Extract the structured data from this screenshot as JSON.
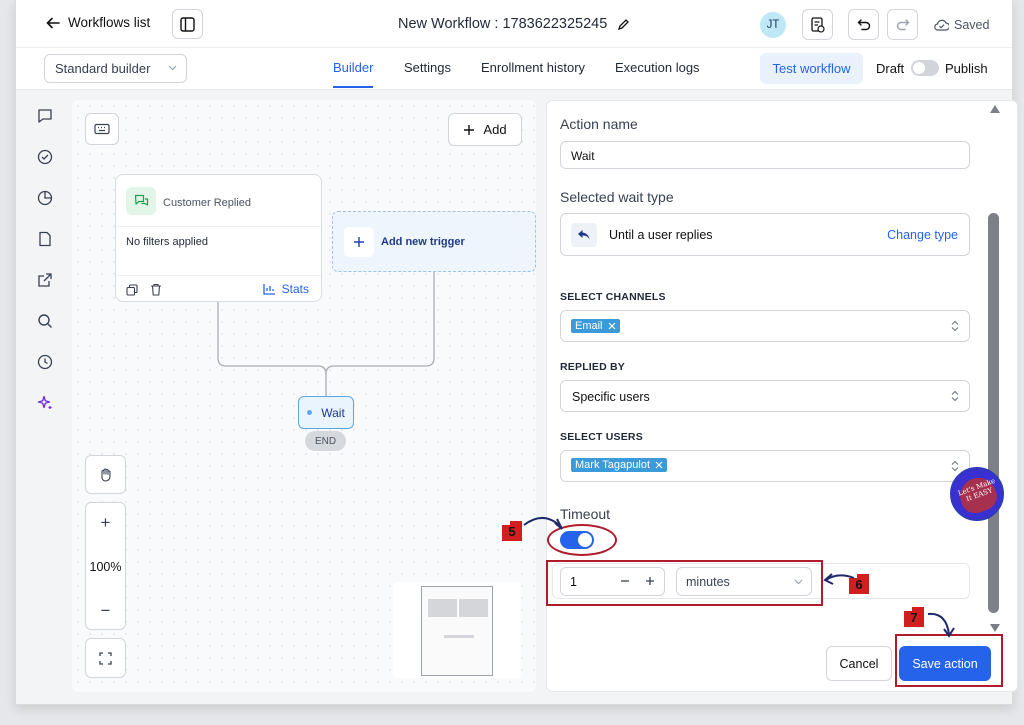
{
  "header": {
    "back_label": "Workflows list",
    "title": "New Workflow : 1783622325245",
    "avatar_initials": "JT",
    "saved_label": "Saved"
  },
  "toolbar": {
    "builder_select": "Standard builder",
    "tabs": [
      "Builder",
      "Settings",
      "Enrollment history",
      "Execution logs"
    ],
    "active_tab": "Builder",
    "test_label": "Test workflow",
    "draft_label": "Draft",
    "publish_label": "Publish"
  },
  "sidebar": {
    "icons": [
      "chat-icon",
      "check-circle-icon",
      "pie-chart-icon",
      "file-icon",
      "external-link-icon",
      "search-icon",
      "history-icon",
      "sparkle-icon"
    ]
  },
  "canvas": {
    "add_label": "Add",
    "trigger_title": "Customer Replied",
    "trigger_filters": "No filters applied",
    "stats_label": "Stats",
    "add_trigger_label": "Add new trigger",
    "wait_label": "Wait",
    "end_label": "END",
    "zoom_level": "100%",
    "zoom_in": "+",
    "zoom_out": "−"
  },
  "panel": {
    "action_name_label": "Action name",
    "action_name_value": "Wait",
    "wait_type_label": "Selected wait type",
    "wait_type_value": "Until a user replies",
    "change_type_label": "Change type",
    "channels_label": "SELECT CHANNELS",
    "channel_chip": "Email",
    "replied_by_label": "REPLIED BY",
    "replied_by_value": "Specific users",
    "users_label": "SELECT USERS",
    "user_chip": "Mark Tagapulot",
    "timeout_label": "Timeout",
    "timeout_enabled": true,
    "timeout_value": "1",
    "timeout_unit": "minutes",
    "cancel_label": "Cancel",
    "save_label": "Save action"
  },
  "annotations": {
    "step5": "5",
    "step6": "6",
    "step7": "7",
    "badge_text": "Let's Make It EASY"
  },
  "colors": {
    "accent": "#2563eb",
    "annotation_red": "#b01c2b",
    "chip_blue": "#3b9ad9"
  }
}
